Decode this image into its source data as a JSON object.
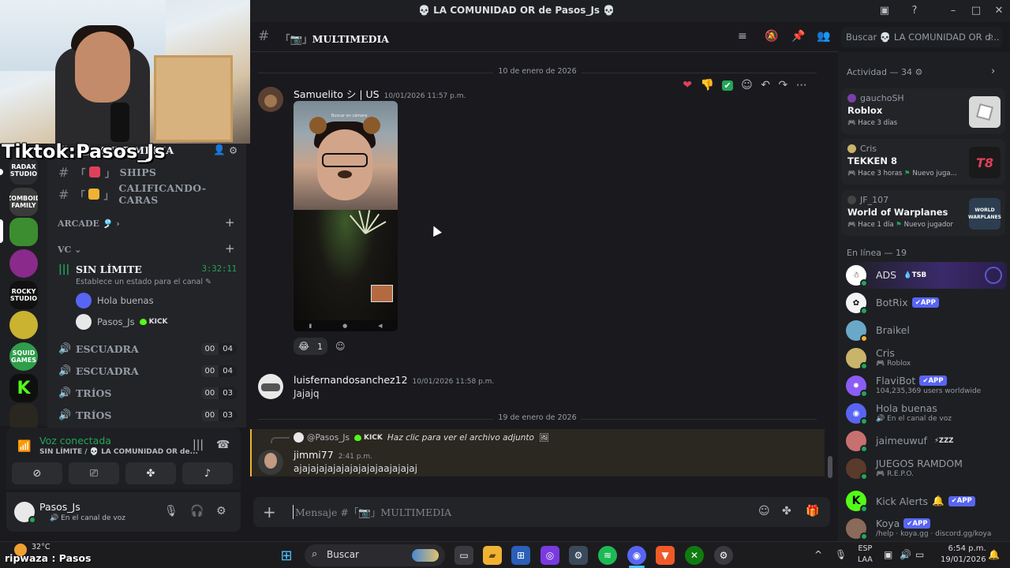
{
  "window": {
    "title": "💀 LA COMUNIDAD OR de Pasos_Js 💀"
  },
  "overlay": {
    "tiktok_handle": "Tiktok:Pasos_Js",
    "bottom_tag": "ripwaza : Pasos"
  },
  "sidebar": {
    "partial_channel": "MULTIMEDIA",
    "channels": [
      {
        "label": "SHIPS",
        "emoji_color": "#e0405a"
      },
      {
        "label": "CALIFICANDO-CARAS",
        "emoji_color": "#f0b232"
      }
    ],
    "category_arcade": "ARCADE 🎐",
    "category_vc": "VC",
    "active_voice": {
      "label": "SIN LÍMITE",
      "timer": "3:32:11",
      "status_placeholder": "Establece un estado para el canal",
      "members": [
        {
          "name": "Hola buenas",
          "badge": ""
        },
        {
          "name": "Pasos_Js",
          "badge": "KICK"
        }
      ]
    },
    "voice_channels": [
      {
        "label": "ESCUADRA",
        "count": "00",
        "limit": "04"
      },
      {
        "label": "ESCUADRA",
        "count": "00",
        "limit": "04"
      },
      {
        "label": "TRÍOS",
        "count": "00",
        "limit": "03"
      },
      {
        "label": "TRÍOS",
        "count": "00",
        "limit": "03"
      }
    ],
    "servers": [
      {
        "label": "RADAX STUDIO",
        "color": "#2b2d31"
      },
      {
        "label": "ZOMBOID FAMILY",
        "color": "#3a3a3a"
      },
      {
        "label": "",
        "color": "#3c8d2f"
      },
      {
        "label": "",
        "color": "#8a2a8a"
      },
      {
        "label": "ROCKY STUDIO",
        "color": "#111111"
      },
      {
        "label": "",
        "color": "#c9b331"
      },
      {
        "label": "SQUID GAMES",
        "color": "#2e9e4a"
      },
      {
        "label": "K",
        "color": "#0f0f0f"
      },
      {
        "label": "",
        "color": "#2a2620"
      }
    ]
  },
  "voice_panel": {
    "title": "Voz conectada",
    "subtitle": "SIN LÍMITE / 💀 LA COMUNIDAD OR de..."
  },
  "user_panel": {
    "name": "Pasos_Js",
    "status": "En el canal de voz"
  },
  "chat": {
    "channel_name": "MULTIMEDIA",
    "search_placeholder": "Buscar 💀 LA COMUNIDAD OR d...",
    "composer_placeholder": "Mensaje #「📷」MULTIMEDIA",
    "dividers": [
      "10 de enero de 2026",
      "19 de enero de 2026"
    ],
    "photo_caption": "Buscar en cámara",
    "messages": [
      {
        "author": "Samuelito シ | US",
        "time": "10/01/2026 11:57 p.m.",
        "text": "",
        "reaction_count": "1"
      },
      {
        "author": "luisfernandosanchez12",
        "time": "10/01/2026 11:58 p.m.",
        "text": "Jajajq"
      },
      {
        "author": "jimmi77",
        "time": "2:41 p.m.",
        "text": "ajajajajajajajajajajaajajajaj",
        "reply_to": "@Pasos_Js",
        "reply_badge": "KICK",
        "reply_text": "Haz clic para ver el archivo adjunto"
      }
    ]
  },
  "members": {
    "activity_header": "Actividad — 34",
    "activities": [
      {
        "user": "gauchoSH",
        "game": "Roblox",
        "meta": "Hace 3 días",
        "art": "",
        "art_color": "#d9d9d9",
        "user_color": "#7b3fa8"
      },
      {
        "user": "Cris",
        "game": "TEKKEN 8",
        "meta": "Hace 3 horas",
        "extra": "Nuevo juga...",
        "art": "T8",
        "art_color": "#1a1a1a",
        "user_color": "#c8b56a"
      },
      {
        "user": "JF_107",
        "game": "World of Warplanes",
        "meta": "Hace 1 día",
        "extra": "Nuevo jugador",
        "art": "WORLD WARPLANES",
        "art_color": "#2c3e50",
        "user_color": "#444444"
      }
    ],
    "online_header": "En línea — 19",
    "online": [
      {
        "name": "ADS",
        "tag": "TSB",
        "sub": "",
        "color": "#ffffff"
      },
      {
        "name": "BotRix",
        "tag": "APP",
        "sub": "",
        "color": "#f2f3f5"
      },
      {
        "name": "Braikel",
        "tag": "",
        "sub": "",
        "color": "#6aa8c8"
      },
      {
        "name": "Cris",
        "tag": "",
        "sub": "Roblox",
        "color": "#c8b56a"
      },
      {
        "name": "FlaviBot",
        "tag": "APP",
        "sub": "104,235,369 users worldwide",
        "color": "#8b5cf6"
      },
      {
        "name": "Hola buenas",
        "tag": "",
        "sub": "En el canal de voz",
        "color": "#5865f2"
      },
      {
        "name": "jaimeuwuf",
        "tag": "ZZZ",
        "sub": "",
        "color": "#c87070"
      },
      {
        "name": "JUEGOS RAMDOM",
        "tag": "",
        "sub": "R.E.P.O.",
        "color": "#5a3a2a"
      },
      {
        "name": "Kick Alerts",
        "tag": "APP",
        "sub": "",
        "color": "#53fc18"
      },
      {
        "name": "Koya",
        "tag": "APP",
        "sub": "/help · koya.gg · discord.gg/koya",
        "color": "#8a6a5a"
      }
    ]
  },
  "taskbar": {
    "temperature": "32°C",
    "search": "Buscar",
    "lang_top": "ESP",
    "lang_bottom": "LAA",
    "time": "6:54 p.m.",
    "date": "19/01/2026"
  },
  "colors": {
    "online": "#23a55a",
    "idle": "#f0b232",
    "accent": "#5865f2"
  }
}
